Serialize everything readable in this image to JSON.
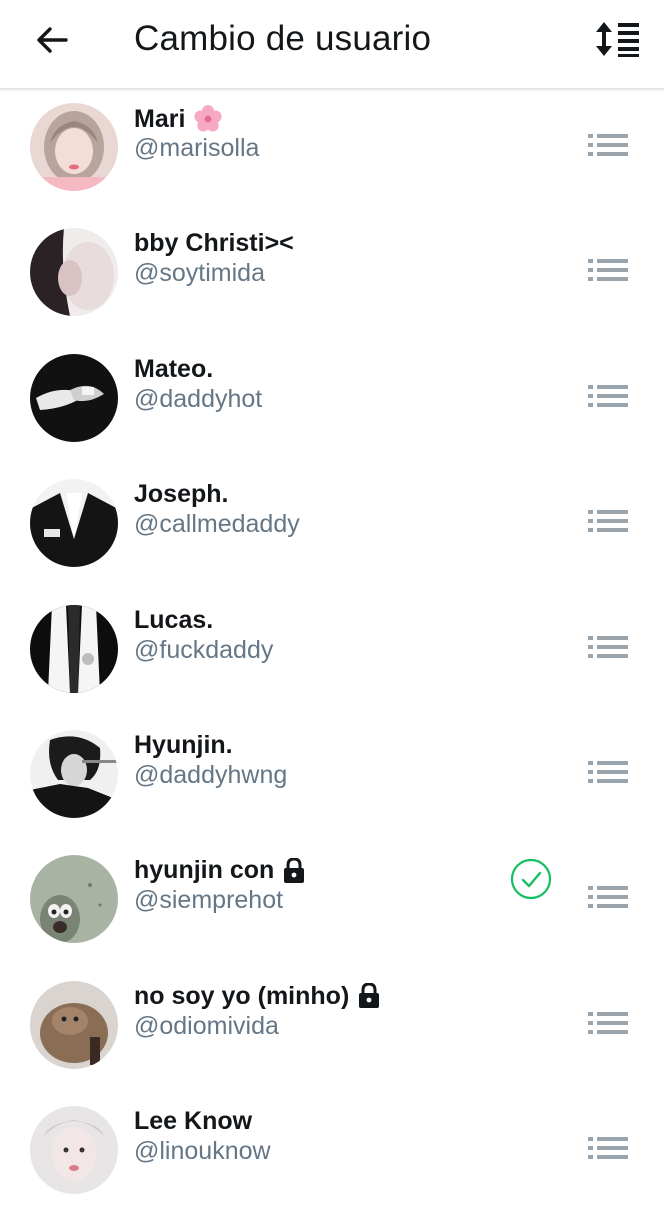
{
  "header": {
    "title": "Cambio de usuario",
    "back_icon": "arrow-left-icon",
    "sort_icon": "reorder-sort-icon"
  },
  "colors": {
    "text_primary": "#14171a",
    "text_secondary": "#657786",
    "drag_handle": "#9aa4ad",
    "check_green": "#17bf63"
  },
  "accounts": [
    {
      "name": "Mari",
      "name_suffix_icon": "cherry-blossom-emoji-icon",
      "handle": "@marisolla",
      "protected": false,
      "selected": false
    },
    {
      "name": "bby Christi><",
      "handle": "@soytimida",
      "protected": false,
      "selected": false
    },
    {
      "name": "Mateo.",
      "handle": "@daddyhot",
      "protected": false,
      "selected": false
    },
    {
      "name": "Joseph.",
      "handle": "@callmedaddy",
      "protected": false,
      "selected": false
    },
    {
      "name": "Lucas.",
      "handle": "@fuckdaddy",
      "protected": false,
      "selected": false
    },
    {
      "name": "Hyunjin.",
      "handle": "@daddyhwng",
      "protected": false,
      "selected": false
    },
    {
      "name": "hyunjin con",
      "handle": "@siemprehot",
      "protected": true,
      "selected": true
    },
    {
      "name": "no soy yo (minho)",
      "handle": "@odiomivida",
      "protected": true,
      "selected": false
    },
    {
      "name": "Lee Know",
      "handle": "@linouknow",
      "protected": false,
      "selected": false
    }
  ]
}
